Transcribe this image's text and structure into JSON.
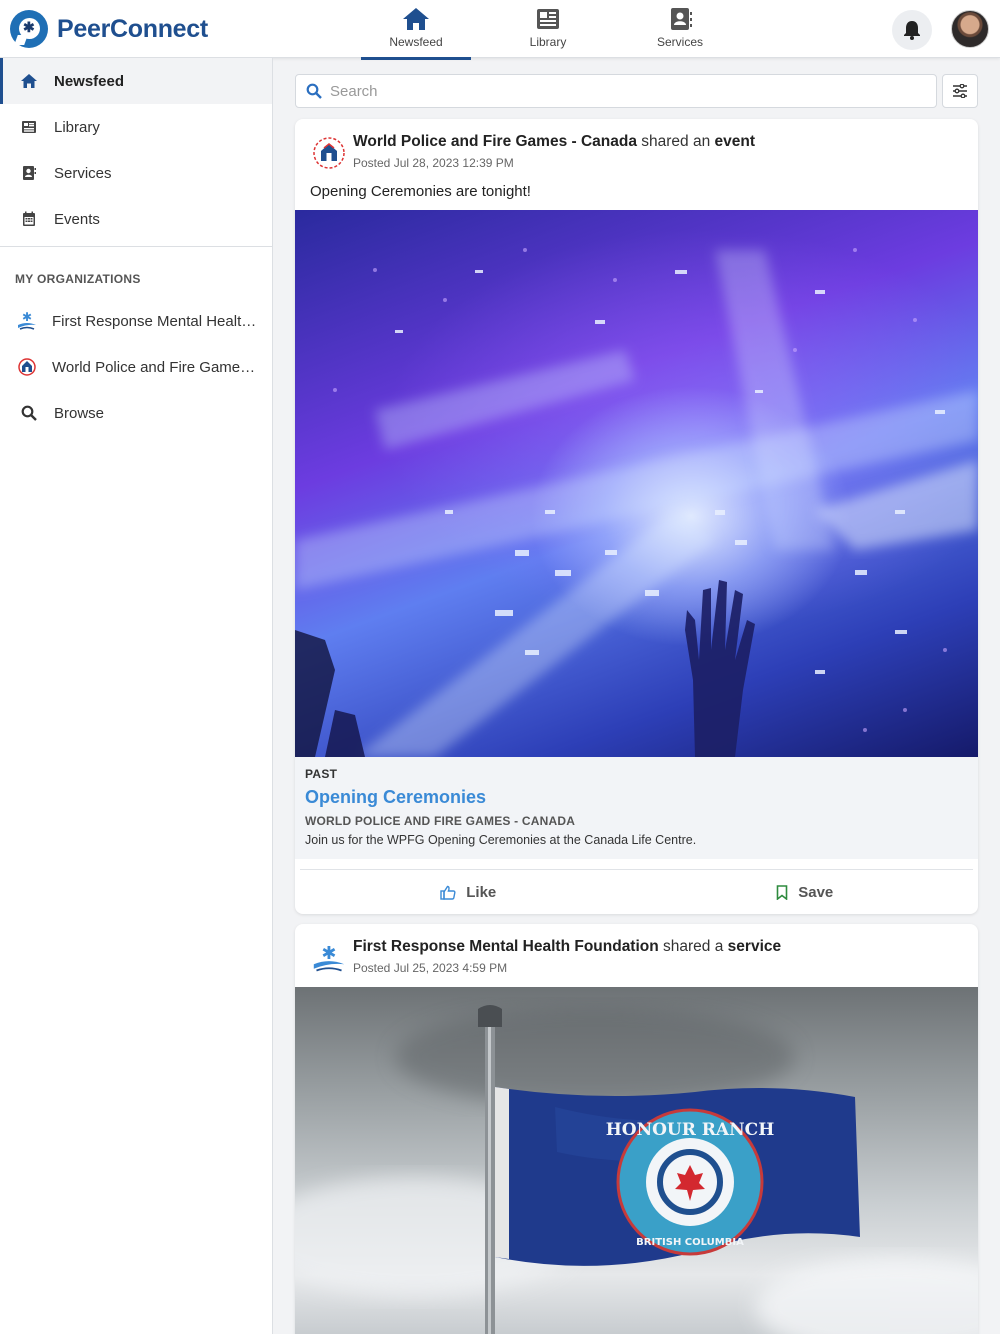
{
  "app": {
    "name": "PeerConnect"
  },
  "topnav": [
    {
      "label": "Newsfeed",
      "icon": "home-icon",
      "active": true
    },
    {
      "label": "Library",
      "icon": "newspaper-icon",
      "active": false
    },
    {
      "label": "Services",
      "icon": "contact-book-icon",
      "active": false
    }
  ],
  "sidebar": {
    "items": [
      {
        "label": "Newsfeed",
        "icon": "home-icon",
        "active": true
      },
      {
        "label": "Library",
        "icon": "newspaper-icon",
        "active": false
      },
      {
        "label": "Services",
        "icon": "contact-book-icon",
        "active": false
      },
      {
        "label": "Events",
        "icon": "calendar-icon",
        "active": false
      }
    ],
    "section_title": "MY ORGANIZATIONS",
    "orgs": [
      {
        "label": "First Response Mental Health Foundation",
        "icon": "frmhf-logo-icon"
      },
      {
        "label": "World Police and Fire Games - Canada",
        "icon": "wpfg-logo-icon"
      }
    ],
    "browse_label": "Browse"
  },
  "search": {
    "placeholder": "Search"
  },
  "posts": [
    {
      "org": "World Police and Fire Games - Canada",
      "action_text": "shared an",
      "object_type": "event",
      "posted": "Posted Jul 28, 2023 12:39 PM",
      "text": "Opening Ceremonies are tonight!",
      "image_description": "concert-confetti-photo",
      "event": {
        "status": "PAST",
        "title": "Opening Ceremonies",
        "org": "WORLD POLICE AND FIRE GAMES - CANADA",
        "description": "Join us for the WPFG Opening Ceremonies at the Canada Life Centre."
      },
      "like_label": "Like",
      "save_label": "Save"
    },
    {
      "org": "First Response Mental Health Foundation",
      "action_text": "shared a",
      "object_type": "service",
      "posted": "Posted Jul 25, 2023 4:59 PM",
      "image_description": "honour-ranch-flag-photo",
      "flag": {
        "top_text": "HONOUR RANCH",
        "bottom_text": "BRITISH COLUMBIA"
      }
    }
  ],
  "colors": {
    "brand": "#1f4f8f",
    "link": "#3a8ad6",
    "like": "#3a8ad6",
    "save": "#2e8b3e"
  }
}
